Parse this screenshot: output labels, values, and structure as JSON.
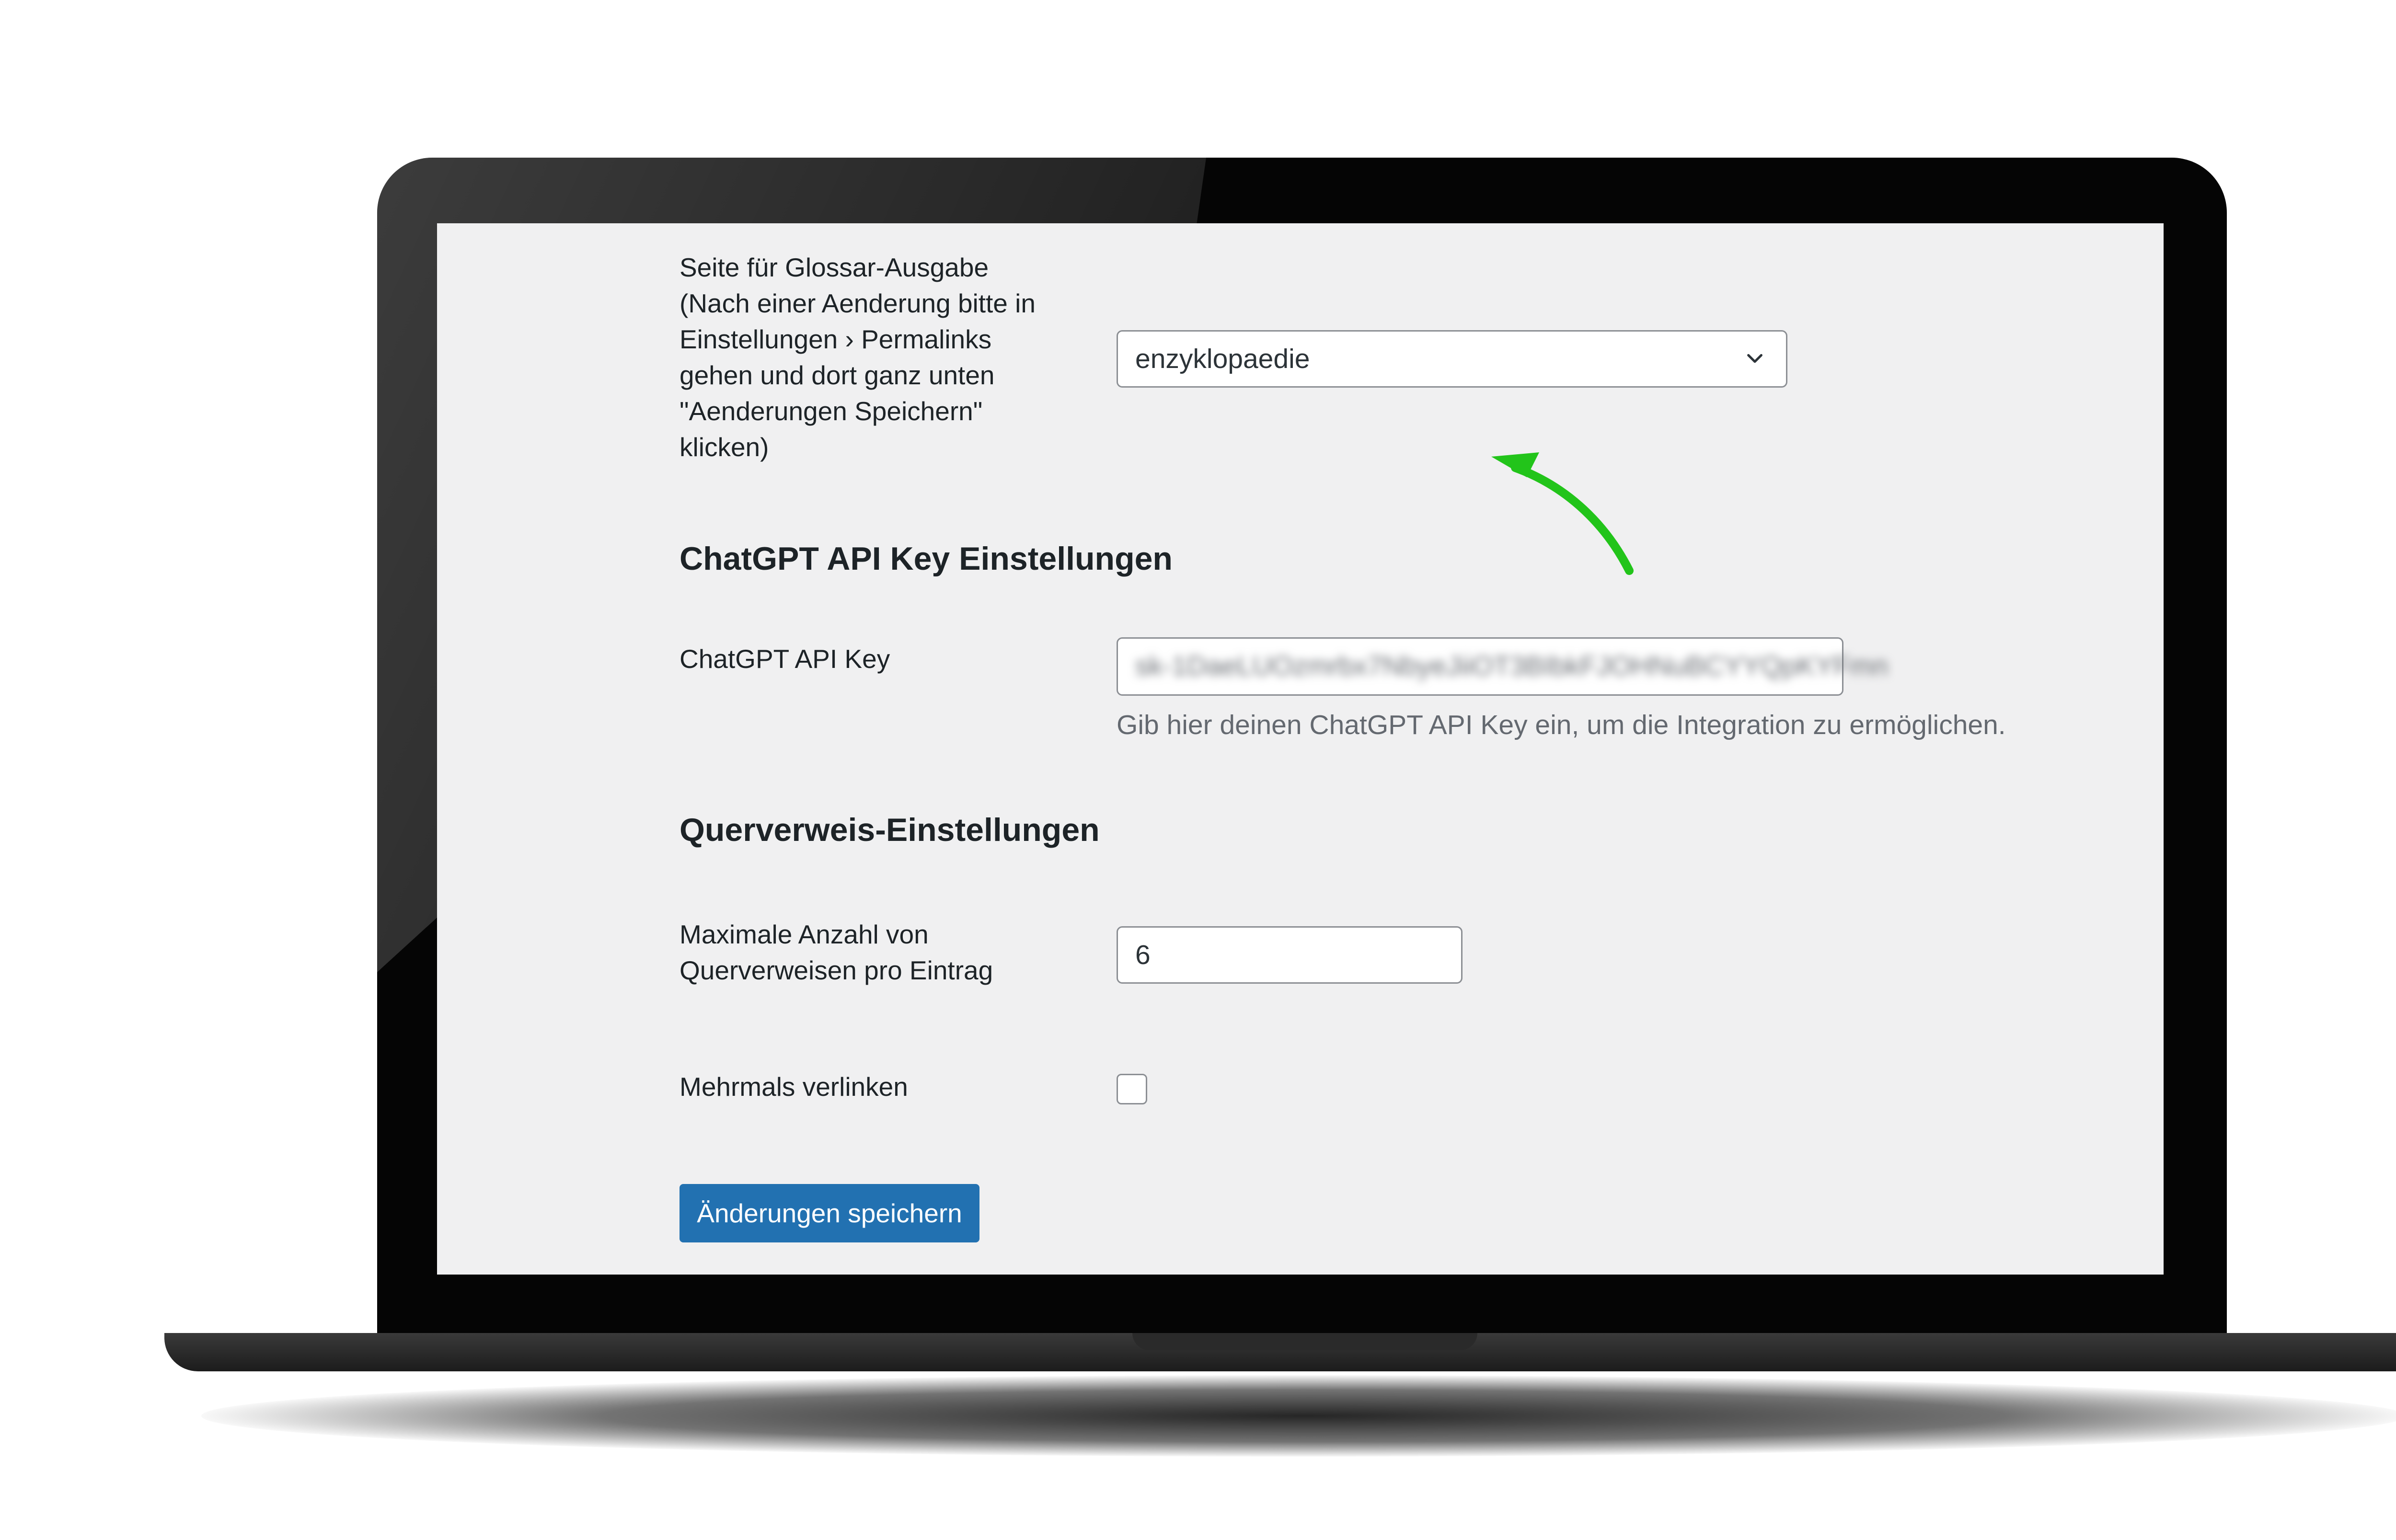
{
  "settings": {
    "glossary_page": {
      "label_lines": [
        "Seite für Glossar-Ausgabe",
        "(Nach einer Aenderung bitte in",
        "Einstellungen › Permalinks",
        "gehen und dort ganz unten",
        "\"Aenderungen Speichern\"",
        "klicken)"
      ],
      "selected_value": "enzyklopaedie"
    },
    "chatgpt_section": {
      "heading": "ChatGPT API Key Einstellungen",
      "api_key_label": "ChatGPT API Key",
      "api_key_value": "sk-1DaeLUOzmrbx7NbyeJiiOT3BIbkFJOHNuBCYYQpKYFmn",
      "api_key_description": "Gib hier deinen ChatGPT API Key ein, um die Integration zu ermöglichen."
    },
    "crossref_section": {
      "heading": "Querverweis-Einstellungen",
      "max_label_lines": [
        "Maximale Anzahl von",
        "Querverweisen pro Eintrag"
      ],
      "max_value": "6",
      "multi_link_label": "Mehrmals verlinken",
      "multi_link_checked": false
    },
    "save_button": "Änderungen speichern"
  },
  "colors": {
    "accent": "#2271b1",
    "annotation_arrow": "#22c41a",
    "panel_background": "#f0f0f1"
  },
  "icons": {
    "select_chevron": "chevron-down-icon",
    "annotation": "green-curved-arrow-icon"
  }
}
